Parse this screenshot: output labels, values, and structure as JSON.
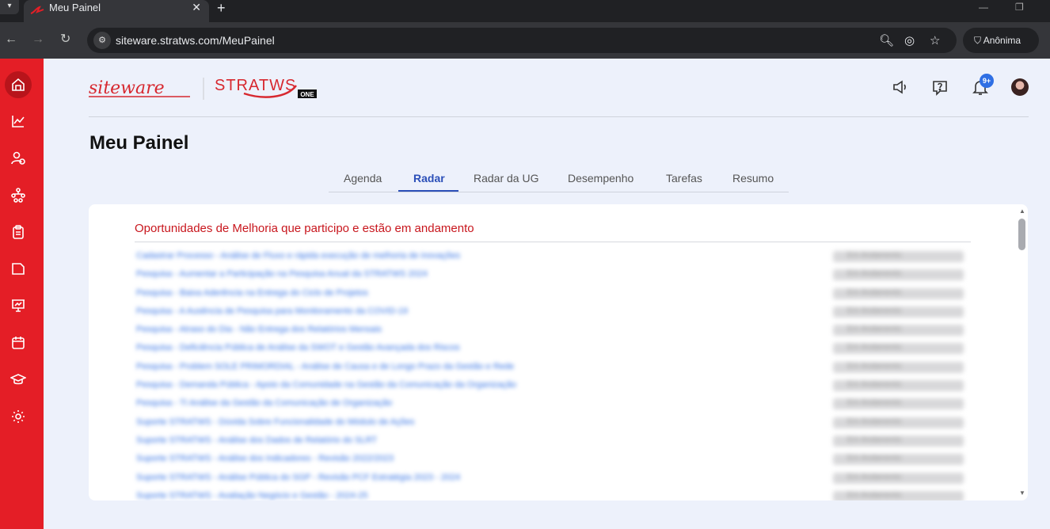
{
  "browser": {
    "tab_title": "Meu Painel",
    "url": "siteware.stratws.com/MeuPainel",
    "profile_label": "Anônima"
  },
  "app": {
    "logo_text": "siteware",
    "product_text": "STRATWS",
    "product_badge": "ONE",
    "notifications_badge": "9+",
    "page_title": "Meu Painel",
    "tabs": [
      {
        "label": "Agenda"
      },
      {
        "label": "Radar",
        "active": true
      },
      {
        "label": "Radar da UG"
      },
      {
        "label": "Desempenho"
      },
      {
        "label": "Tarefas"
      },
      {
        "label": "Resumo"
      }
    ],
    "section_title": "Oportunidades de Melhoria que participo e estão em andamento",
    "nav_icons": [
      "home-icon",
      "chart-icon",
      "user-check-icon",
      "org-icon",
      "clipboard-icon",
      "folder-icon",
      "presentation-icon",
      "calendar-icon",
      "graduation-icon",
      "settings-icon"
    ],
    "rows": [
      {
        "text": "Cadastrar Processo - Análise de Fluxo e rápida execução de melhoria de inovações",
        "status": "Em Andamento"
      },
      {
        "text": "Pesquisa - Aumentar a Participação na Pesquisa Anual da STRATWS 2024",
        "status": "Em Andamento"
      },
      {
        "text": "Pesquisa - Baixa Aderência na Entrega do Ciclo de Projetos",
        "status": "Em Andamento"
      },
      {
        "text": "Pesquisa - A Ausência de Pesquisa para Monitoramento da COVID-19",
        "status": "Em Andamento"
      },
      {
        "text": "Pesquisa - Atraso do Dia - Não Entrega dos Relatórios Mensais",
        "status": "Em Andamento"
      },
      {
        "text": "Pesquisa - Deficiência Pública de Análise da SWOT e Gestão Avançada dos Riscos",
        "status": "Em Andamento"
      },
      {
        "text": "Pesquisa - Problem SOLE PRIMORDIAL - Análise de Causa e de Longo Prazo da Gestão e Rede",
        "status": "Em Andamento"
      },
      {
        "text": "Pesquisa - Demanda Pública - Apoio da Comunidade na Gestão da Comunicação da Organização",
        "status": "Em Andamento"
      },
      {
        "text": "Pesquisa - TI Análise da Gestão da Comunicação de Organização",
        "status": "Em Andamento"
      },
      {
        "text": "Suporte STRATWS - Dúvida Sobre Funcionalidade do Módulo de Ações",
        "status": "Em Andamento"
      },
      {
        "text": "Suporte STRATWS - Análise dos Dados de Relatório do SLRT",
        "status": "Em Andamento"
      },
      {
        "text": "Suporte STRATWS - Análise dos Indicadores - Revisão 2022/2023",
        "status": "Em Andamento"
      },
      {
        "text": "Suporte STRATWS - Análise Pública do SGP - Revisão PCF Estratégia 2023 - 2024",
        "status": "Em Andamento"
      },
      {
        "text": "Suporte STRATWS - Avaliação Negócio e Gestão - 2024-25",
        "status": "Em Andamento"
      }
    ]
  }
}
